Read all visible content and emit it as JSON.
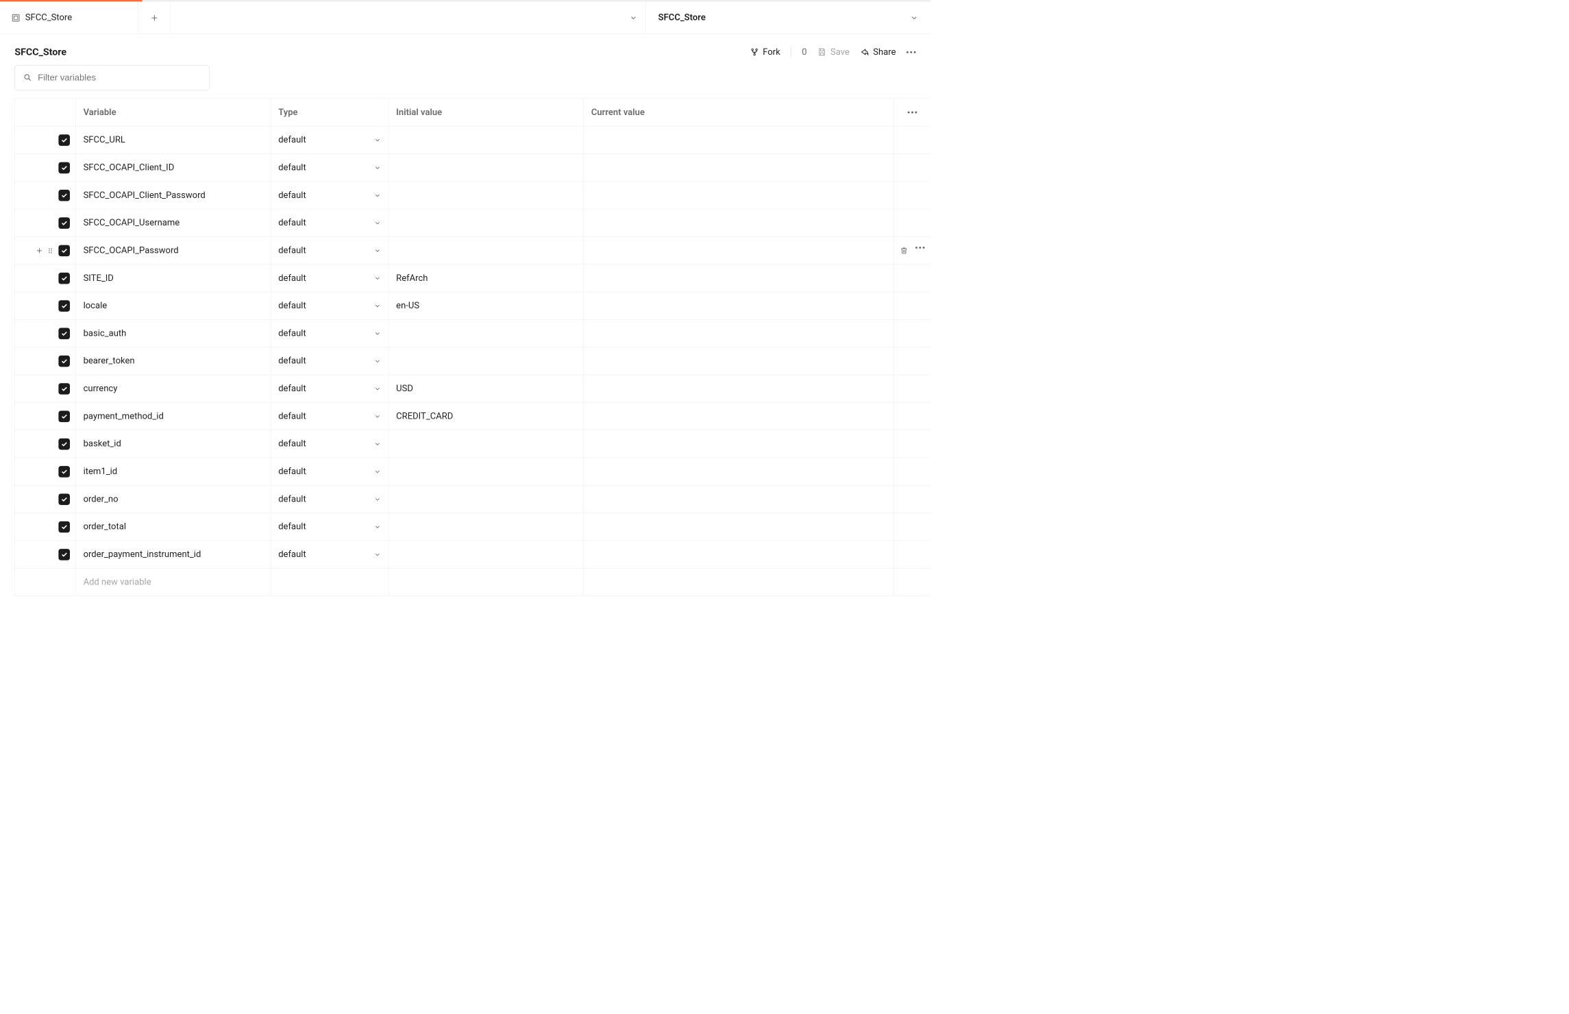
{
  "tab": {
    "title": "SFCC_Store"
  },
  "context": {
    "title": "SFCC_Store"
  },
  "page": {
    "title": "SFCC_Store"
  },
  "actions": {
    "fork": "Fork",
    "fork_count": "0",
    "save": "Save",
    "share": "Share"
  },
  "filter": {
    "placeholder": "Filter variables"
  },
  "columns": {
    "variable": "Variable",
    "type": "Type",
    "initial": "Initial value",
    "current": "Current value"
  },
  "newrow_placeholder": "Add new variable",
  "rows": [
    {
      "checked": true,
      "variable": "SFCC_URL",
      "type": "default",
      "initial": "",
      "current": ""
    },
    {
      "checked": true,
      "variable": "SFCC_OCAPI_Client_ID",
      "type": "default",
      "initial": "",
      "current": ""
    },
    {
      "checked": true,
      "variable": "SFCC_OCAPI_Client_Password",
      "type": "default",
      "initial": "",
      "current": ""
    },
    {
      "checked": true,
      "variable": "SFCC_OCAPI_Username",
      "type": "default",
      "initial": "",
      "current": ""
    },
    {
      "checked": true,
      "variable": "SFCC_OCAPI_Password",
      "type": "default",
      "initial": "",
      "current": "",
      "hovered": true
    },
    {
      "checked": true,
      "variable": "SITE_ID",
      "type": "default",
      "initial": "RefArch",
      "current": ""
    },
    {
      "checked": true,
      "variable": "locale",
      "type": "default",
      "initial": "en-US",
      "current": ""
    },
    {
      "checked": true,
      "variable": "basic_auth",
      "type": "default",
      "initial": "",
      "current": ""
    },
    {
      "checked": true,
      "variable": "bearer_token",
      "type": "default",
      "initial": "",
      "current": ""
    },
    {
      "checked": true,
      "variable": "currency",
      "type": "default",
      "initial": "USD",
      "current": ""
    },
    {
      "checked": true,
      "variable": "payment_method_id",
      "type": "default",
      "initial": "CREDIT_CARD",
      "current": ""
    },
    {
      "checked": true,
      "variable": "basket_id",
      "type": "default",
      "initial": "",
      "current": ""
    },
    {
      "checked": true,
      "variable": "item1_id",
      "type": "default",
      "initial": "",
      "current": ""
    },
    {
      "checked": true,
      "variable": "order_no",
      "type": "default",
      "initial": "",
      "current": ""
    },
    {
      "checked": true,
      "variable": "order_total",
      "type": "default",
      "initial": "",
      "current": ""
    },
    {
      "checked": true,
      "variable": "order_payment_instrument_id",
      "type": "default",
      "initial": "",
      "current": ""
    }
  ]
}
